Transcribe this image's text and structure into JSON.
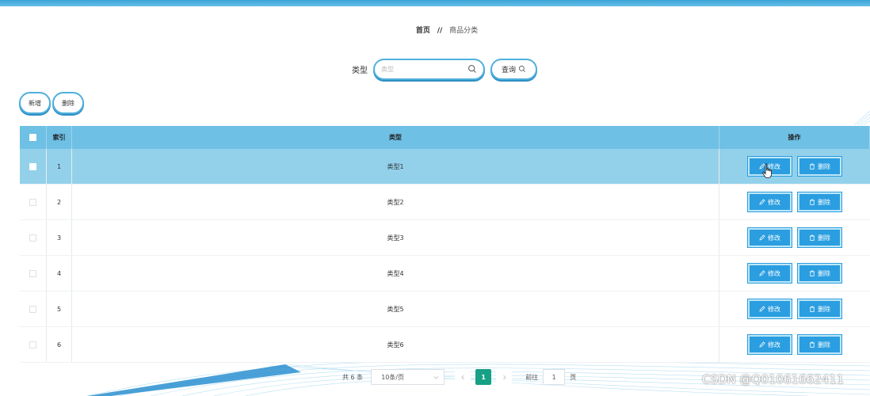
{
  "breadcrumb": {
    "home": "首页",
    "separator": "//",
    "current": "商品分类"
  },
  "search": {
    "label": "类型",
    "placeholder": "类型",
    "query_label": "查询"
  },
  "actions": {
    "add_label": "新增",
    "delete_label": "删除"
  },
  "table": {
    "headers": {
      "index": "索引",
      "type": "类型",
      "ops": "操作"
    },
    "rows": [
      {
        "index": "1",
        "type": "类型1"
      },
      {
        "index": "2",
        "type": "类型2"
      },
      {
        "index": "3",
        "type": "类型3"
      },
      {
        "index": "4",
        "type": "类型4"
      },
      {
        "index": "5",
        "type": "类型5"
      },
      {
        "index": "6",
        "type": "类型6"
      }
    ],
    "edit_label": "修改",
    "delete_label": "删除",
    "hovered_row": "1"
  },
  "pager": {
    "total": "共 6 条",
    "page_size": "10条/页",
    "current_page": "1",
    "goto_label": "前往",
    "goto_value": "1",
    "page_suffix": "页"
  },
  "watermark": "CSDN @Q01061662411",
  "colors": {
    "accent": "#2a9ee0",
    "header_bg": "#6fc0e5",
    "hover_row_bg": "#93d1eb",
    "active_page": "#16a085"
  },
  "icons": {
    "search": "search-icon",
    "edit": "edit-icon",
    "delete": "trash-icon",
    "prev": "chevron-left-icon",
    "next": "chevron-right-icon",
    "dropdown": "chevron-down-icon"
  }
}
